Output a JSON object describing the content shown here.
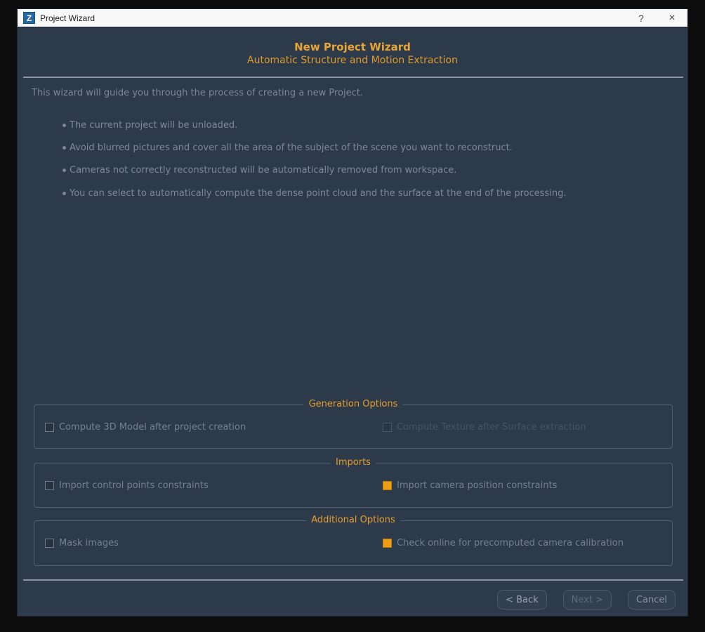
{
  "window": {
    "title": "Project Wizard",
    "icon_letter": "Z",
    "help_label": "?",
    "close_label": "×"
  },
  "header": {
    "title": "New Project Wizard",
    "subtitle": "Automatic Structure and Motion Extraction"
  },
  "intro": {
    "lead": "This wizard will guide you through the process of creating a new Project.",
    "bullets": [
      "The current project will be unloaded.",
      "Avoid blurred pictures and cover all the area of the subject of the scene you want to reconstruct.",
      "Cameras not correctly reconstructed will be automatically removed from workspace.",
      "You can select to automatically compute the dense point cloud and the surface at the end of the processing."
    ]
  },
  "groups": [
    {
      "title": "Generation Options",
      "checkboxes": [
        {
          "label": "Compute 3D Model after project creation",
          "checked": false,
          "enabled": true
        },
        {
          "label": "Compute Texture after Surface extraction",
          "checked": false,
          "enabled": false
        }
      ]
    },
    {
      "title": "Imports",
      "checkboxes": [
        {
          "label": "Import control points constraints",
          "checked": false,
          "enabled": true
        },
        {
          "label": "Import camera position constraints",
          "checked": true,
          "enabled": true
        }
      ]
    },
    {
      "title": "Additional Options",
      "checkboxes": [
        {
          "label": "Mask images",
          "checked": false,
          "enabled": true
        },
        {
          "label": "Check online for precomputed camera calibration",
          "checked": true,
          "enabled": true
        }
      ]
    }
  ],
  "footer": {
    "back_label": "< Back",
    "next_label": "Next >",
    "cancel_label": "Cancel"
  },
  "colors": {
    "dialog_bg": "#2d3a49",
    "outer_bg": "#0c0c0c",
    "titlebar_bg": "#f8f8f8",
    "accent_orange": "#eaa437",
    "group_title_orange": "#e69d2e",
    "checkbox_checked_orange": "#ef9e14",
    "body_text": "#7e8896",
    "icon_blue": "#2468a4"
  }
}
